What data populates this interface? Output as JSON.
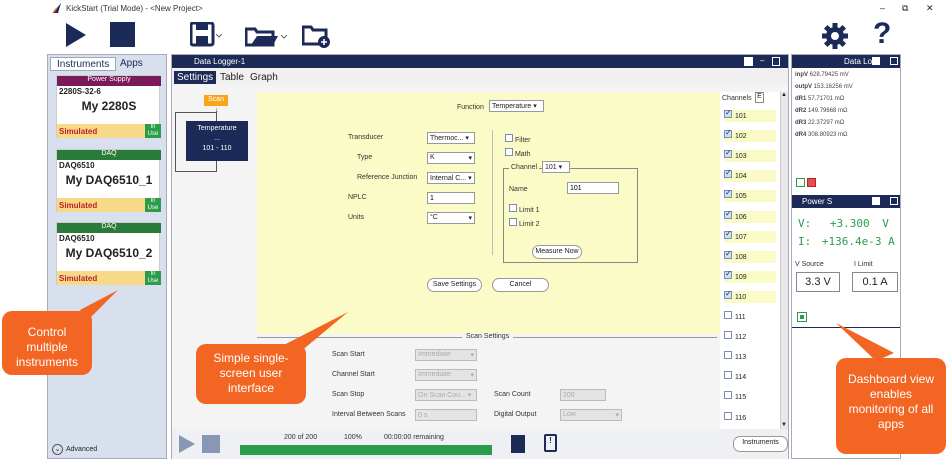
{
  "app": {
    "title": "KickStart (Trial Mode) - <New Project>"
  },
  "window_controls": {
    "minimize": "–",
    "restore": "⧉",
    "close": "✕"
  },
  "left": {
    "tabs": [
      "Instruments",
      "Apps"
    ],
    "cards": [
      {
        "header": "Power Supply",
        "header_color": "#7a1a5a",
        "model": "2280S-32-6",
        "name": "My 2280S",
        "status": "Simulated",
        "badge": "In Use"
      },
      {
        "header": "DAQ",
        "header_color": "#2a7a3a",
        "model": "DAQ6510",
        "name": "My DAQ6510_1",
        "status": "Simulated",
        "badge": "In Use"
      },
      {
        "header": "DAQ",
        "header_color": "#2a7a3a",
        "model": "DAQ6510",
        "name": "My DAQ6510_2",
        "status": "Simulated",
        "badge": "In Use"
      }
    ],
    "advanced": "Advanced"
  },
  "main": {
    "title": "Data Logger-1",
    "tabs": [
      "Settings",
      "Table",
      "Graph"
    ],
    "scan_label": "Scan",
    "block": {
      "line1": "Temperature",
      "line2": "...",
      "line3": "101 - 110"
    },
    "function_label": "Function",
    "function_value": "Temperature",
    "transducer_label": "Transducer",
    "transducer_value": "Thermoc...",
    "type_label": "Type",
    "type_value": "K",
    "refj_label": "Reference Junction",
    "refj_value": "Internal C...",
    "nplc_label": "NPLC",
    "nplc_value": "1",
    "units_label": "Units",
    "units_value": "°C",
    "filter_label": "Filter",
    "math_label": "Math",
    "channel_label": "Channel",
    "channel_value": "101",
    "name_label": "Name",
    "name_value": "101",
    "limit1_label": "Limit 1",
    "limit2_label": "Limit 2",
    "measure_now": "Measure Now",
    "save_settings": "Save Settings",
    "cancel": "Cancel",
    "scan_settings": "Scan Settings",
    "scan_start_label": "Scan Start",
    "scan_start_value": "Immediate",
    "channel_start_label": "Channel Start",
    "channel_start_value": "Immediate",
    "scan_stop_label": "Scan Stop",
    "scan_stop_value": "On Scan Cou...",
    "scan_count_label": "Scan Count",
    "scan_count_value": "200",
    "interval_label": "Interval Between Scans",
    "interval_value": "0 s",
    "digital_output_label": "Digital Output",
    "digital_output_value": "Low",
    "channels_label": "Channels",
    "channels_e": "E",
    "channels": [
      {
        "id": "101",
        "checked": true
      },
      {
        "id": "102",
        "checked": true
      },
      {
        "id": "103",
        "checked": true
      },
      {
        "id": "104",
        "checked": true
      },
      {
        "id": "105",
        "checked": true
      },
      {
        "id": "106",
        "checked": true
      },
      {
        "id": "107",
        "checked": true
      },
      {
        "id": "108",
        "checked": true
      },
      {
        "id": "109",
        "checked": true
      },
      {
        "id": "110",
        "checked": true
      },
      {
        "id": "111",
        "checked": false
      },
      {
        "id": "112",
        "checked": false
      },
      {
        "id": "113",
        "checked": false
      },
      {
        "id": "114",
        "checked": false
      },
      {
        "id": "115",
        "checked": false
      },
      {
        "id": "116",
        "checked": false
      }
    ],
    "progress_count": "200 of 200",
    "progress_pct": "100%",
    "progress_remaining": "00:00:00 remaining",
    "progress_fraction": 1.0,
    "instruments_button": "Instruments"
  },
  "right": {
    "datalog_title": "Data Lo",
    "readings": [
      {
        "label": "inpV",
        "value": "628.79425 mV"
      },
      {
        "label": "outpV",
        "value": "153.16256 mV"
      },
      {
        "label": "dR1",
        "value": "57.71701 mΩ"
      },
      {
        "label": "dR2",
        "value": "149.79668 mΩ"
      },
      {
        "label": "dR3",
        "value": "22.37297 mΩ"
      },
      {
        "label": "dR4",
        "value": "308.80923 mΩ"
      }
    ],
    "power_title": "Power S",
    "v_label": "V:",
    "v_value": "+3.300",
    "v_unit": "V",
    "i_label": "I:",
    "i_value": "+136.4e-3",
    "i_unit": "A",
    "vsource_label": "V Source",
    "ilimit_label": "I Limit",
    "vsource_value": "3.3 V",
    "ilimit_value": "0.1 A"
  },
  "callouts": {
    "control": "Control multiple instruments",
    "simple": "Simple single-screen user interface",
    "dashboard": "Dashboard view enables monitoring of all apps"
  },
  "colors": {
    "navy": "#1b2a56",
    "orange": "#f26522",
    "green": "#2a9c4a"
  }
}
